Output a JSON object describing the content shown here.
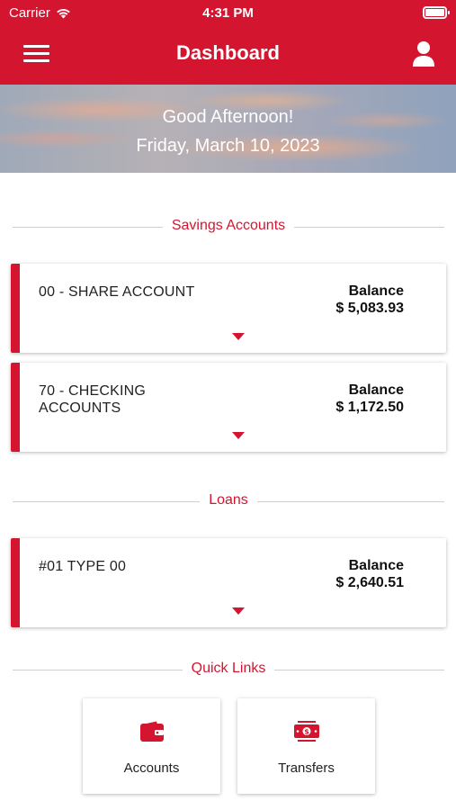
{
  "status_bar": {
    "carrier": "Carrier",
    "time": "4:31 PM"
  },
  "nav": {
    "title": "Dashboard"
  },
  "banner": {
    "greeting": "Good Afternoon!",
    "date": "Friday, March 10, 2023"
  },
  "sections": {
    "savings": "Savings Accounts",
    "loans": "Loans",
    "quick_links": "Quick Links"
  },
  "savings_accounts": [
    {
      "name": "00 - SHARE ACCOUNT",
      "balance_label": "Balance",
      "balance": "$ 5,083.93"
    },
    {
      "name": "70 - CHECKING ACCOUNTS",
      "balance_label": "Balance",
      "balance": "$ 1,172.50"
    }
  ],
  "loans": [
    {
      "name": "#01 TYPE 00",
      "balance_label": "Balance",
      "balance": "$ 2,640.51"
    }
  ],
  "quick_links": [
    {
      "label": "Accounts",
      "icon": "wallet-icon"
    },
    {
      "label": "Transfers",
      "icon": "money-transfer-icon"
    }
  ],
  "colors": {
    "brand": "#d41530",
    "divider": "#cfcfcf",
    "card_bg": "#ffffff"
  }
}
